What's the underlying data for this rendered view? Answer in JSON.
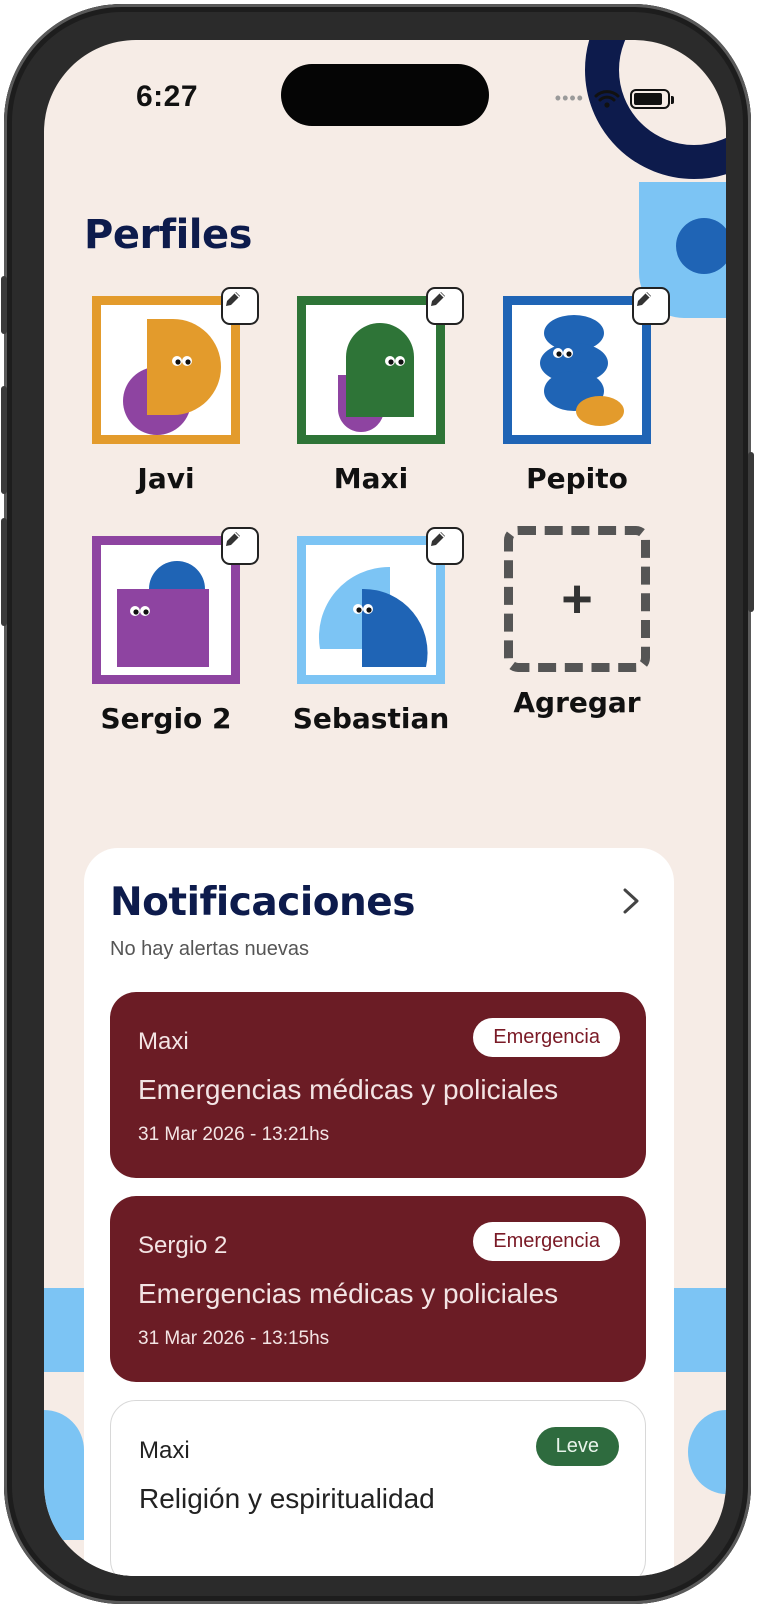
{
  "status_bar": {
    "time": "6:27",
    "signal_dots": "••••"
  },
  "page_title": "Perfiles",
  "profiles": [
    {
      "name": "Javi",
      "color": "#e39b2c"
    },
    {
      "name": "Maxi",
      "color": "#2e7437"
    },
    {
      "name": "Pepito",
      "color": "#1f64b5"
    },
    {
      "name": "Sergio 2",
      "color": "#8e44a1"
    },
    {
      "name": "Sebastian",
      "color": "#7cc4f4"
    }
  ],
  "add_profile": {
    "plus": "+",
    "label": "Agregar"
  },
  "notifications": {
    "title": "Notificaciones",
    "subtitle": "No hay alertas nuevas",
    "items": [
      {
        "profile": "Maxi",
        "badge": "Emergencia",
        "message": "Emergencias médicas y policiales",
        "date": "31 Mar 2026 - 13:21hs"
      },
      {
        "profile": "Sergio 2",
        "badge": "Emergencia",
        "message": "Emergencias médicas y policiales",
        "date": "31 Mar 2026 - 13:15hs"
      },
      {
        "profile": "Maxi",
        "badge": "Leve",
        "message": "Religión y espiritualidad",
        "date": ""
      }
    ]
  },
  "colors": {
    "navy": "#0d1b4c",
    "emergency_bg": "#6b1c25",
    "leve_badge": "#2e6b3e",
    "background": "#f6ece6",
    "light_blue": "#7cc4f4"
  }
}
